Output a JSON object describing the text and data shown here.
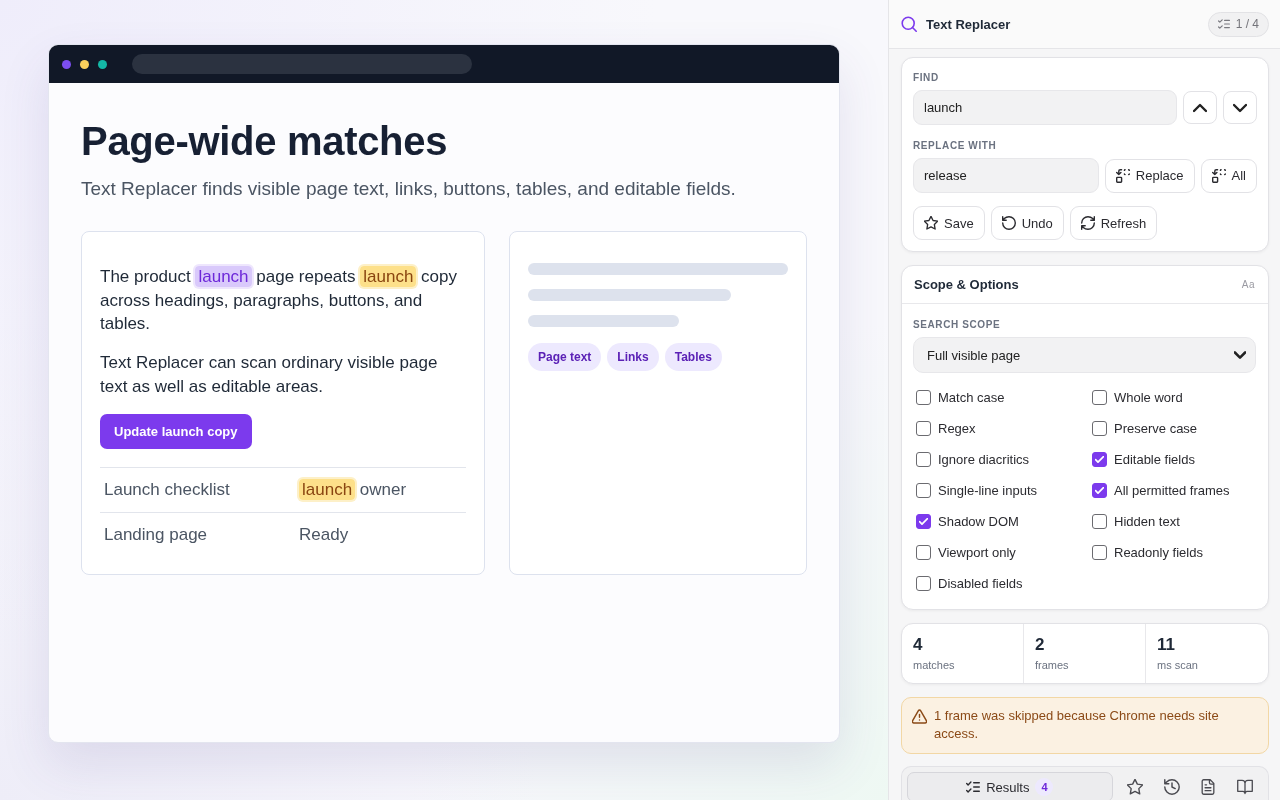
{
  "page": {
    "heading": "Page-wide matches",
    "subtitle": "Text Replacer finds visible page text, links, buttons, tables, and editable fields.",
    "article": {
      "paragraphs": [
        [
          {
            "kind": "text",
            "text": "The product "
          },
          {
            "kind": "current-match",
            "text": "launch"
          },
          {
            "kind": "text",
            "text": " page repeats "
          },
          {
            "kind": "match",
            "text": "launch"
          },
          {
            "kind": "text",
            "text": " copy across headings, paragraphs, buttons, and tables."
          }
        ],
        [
          {
            "kind": "text",
            "text": "Text Replacer can scan ordinary visible page text as well as editable areas."
          }
        ]
      ],
      "button": "Update launch copy",
      "table": {
        "rows": [
          {
            "cells": [
              [
                {
                  "kind": "text",
                  "text": "Launch checklist"
                }
              ],
              [
                {
                  "kind": "match",
                  "text": "launch"
                },
                {
                  "kind": "text",
                  "text": " owner"
                }
              ]
            ]
          },
          {
            "cells": [
              [
                {
                  "kind": "text",
                  "text": "Landing page"
                }
              ],
              [
                {
                  "kind": "text",
                  "text": "Ready"
                }
              ]
            ]
          }
        ]
      }
    },
    "preview": {
      "tags": [
        "Page text",
        "Links",
        "Tables"
      ]
    }
  },
  "panel": {
    "title": "Text Replacer",
    "counter": "1 / 4",
    "find": {
      "label": "FIND",
      "value": "launch"
    },
    "replace": {
      "label": "REPLACE WITH",
      "value": "release",
      "buttons": [
        "Replace",
        "All"
      ]
    },
    "actions": [
      "Save",
      "Undo",
      "Refresh"
    ],
    "options_card": {
      "title": "Scope & Options",
      "case_glyph": "Aa",
      "scope": {
        "label": "SEARCH SCOPE",
        "value": "Full visible page"
      },
      "options": [
        {
          "label": "Match case",
          "checked": false
        },
        {
          "label": "Whole word",
          "checked": false
        },
        {
          "label": "Regex",
          "checked": false
        },
        {
          "label": "Preserve case",
          "checked": false
        },
        {
          "label": "Ignore diacritics",
          "checked": false
        },
        {
          "label": "Editable fields",
          "checked": true
        },
        {
          "label": "Single-line inputs",
          "checked": false
        },
        {
          "label": "All permitted frames",
          "checked": true
        },
        {
          "label": "Shadow DOM",
          "checked": true
        },
        {
          "label": "Hidden text",
          "checked": false
        },
        {
          "label": "Viewport only",
          "checked": false
        },
        {
          "label": "Readonly fields",
          "checked": false
        },
        {
          "label": "Disabled fields",
          "checked": false
        }
      ]
    },
    "stats": [
      {
        "value": "4",
        "label": "matches"
      },
      {
        "value": "2",
        "label": "frames"
      },
      {
        "value": "11",
        "label": "ms scan"
      }
    ],
    "warning": "1 frame was skipped because Chrome needs site access.",
    "tabs": [
      {
        "label": "Results",
        "count": "4",
        "selected": true
      },
      {
        "selected": false
      },
      {
        "selected": false
      },
      {
        "selected": false
      },
      {
        "selected": false
      }
    ]
  }
}
